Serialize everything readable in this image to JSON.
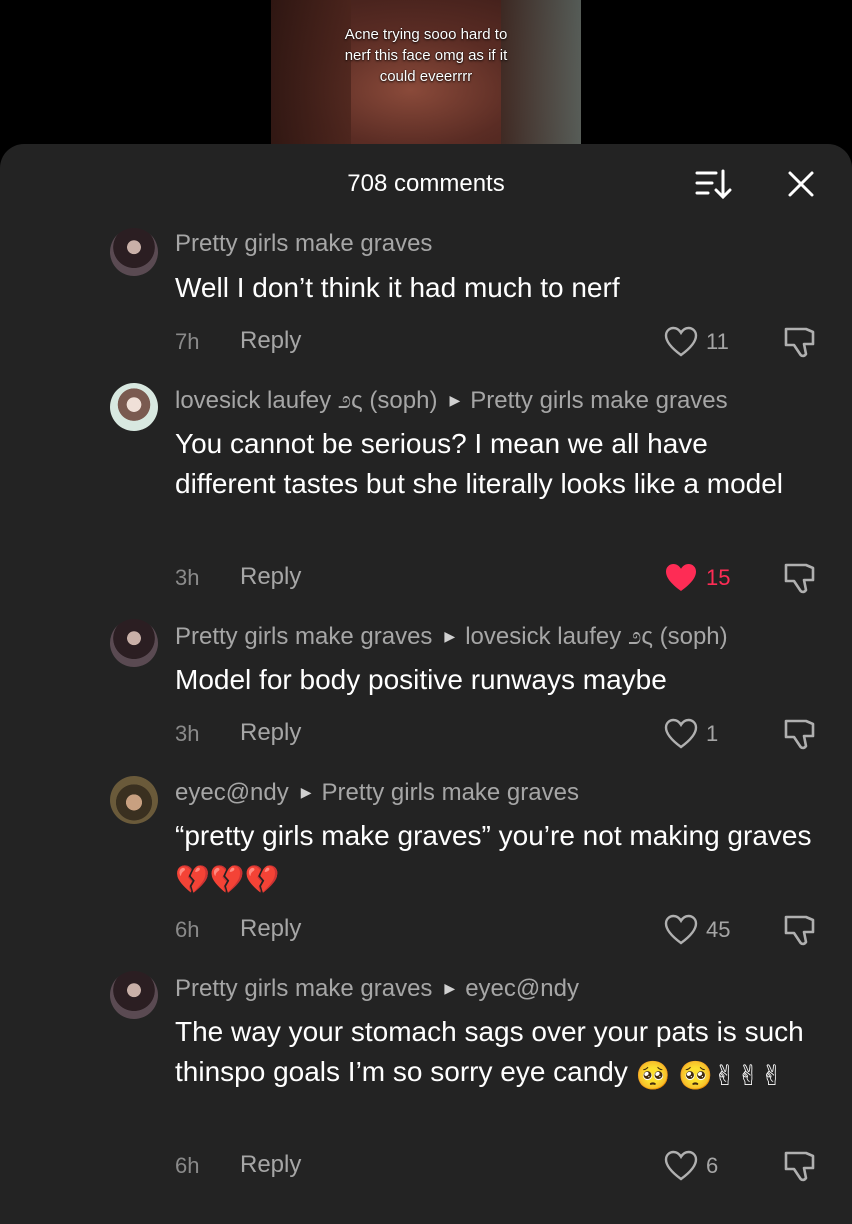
{
  "video": {
    "caption": "Acne trying sooo hard to nerf this face omg as if it could eveerrrr"
  },
  "header": {
    "title": "708 comments"
  },
  "comments": [
    {
      "author": "Pretty girls make graves",
      "reply_to": "",
      "text": "Well I don’t think it had much to nerf",
      "emojis": "",
      "time": "7h",
      "reply_label": "Reply",
      "likes": "11",
      "liked": false
    },
    {
      "author": "lovesick laufey ೨ς (soph)",
      "reply_to": "Pretty girls make graves",
      "text": "You cannot be serious? I mean we all have different tastes but she literally looks like a model",
      "emojis": "",
      "time": "3h",
      "reply_label": "Reply",
      "likes": "15",
      "liked": true
    },
    {
      "author": "Pretty girls make graves",
      "reply_to": "lovesick laufey ೨ς (soph)",
      "text": "Model for body positive runways maybe",
      "emojis": "",
      "time": "3h",
      "reply_label": "Reply",
      "likes": "1",
      "liked": false
    },
    {
      "author": "eyec@ndy",
      "reply_to": "Pretty girls make graves",
      "text": "“pretty girls make graves” you’re not making graves",
      "emojis": "💔💔💔",
      "time": "6h",
      "reply_label": "Reply",
      "likes": "45",
      "liked": false
    },
    {
      "author": "Pretty girls make graves",
      "reply_to": "eyec@ndy",
      "text": "The way your stomach sags over your pats is such thinspo goals I’m so sorry eye candy",
      "emojis": "🥺 🥺✌✌✌",
      "time": "6h",
      "reply_label": "Reply",
      "likes": "6",
      "liked": false
    }
  ],
  "colors": {
    "sheet": "#232323",
    "like_red": "#fe2c55",
    "muted": "#a6a6a6"
  }
}
